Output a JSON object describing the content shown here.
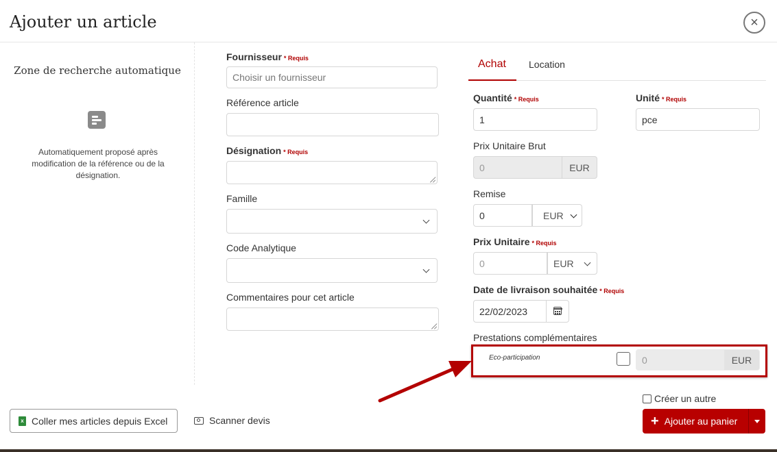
{
  "dialog": {
    "title": "Ajouter un article",
    "close_symbol": "×"
  },
  "auto_zone": {
    "title": "Zone de recherche automatique",
    "icon": "document-icon",
    "description": "Automatiquement proposé après modification de la référence ou de la désignation."
  },
  "required_text": "* Requis",
  "form": {
    "fournisseur": {
      "label": "Fournisseur",
      "placeholder": "Choisir un fournisseur"
    },
    "reference": {
      "label": "Référence article",
      "value": ""
    },
    "designation": {
      "label": "Désignation",
      "value": ""
    },
    "famille": {
      "label": "Famille",
      "value": ""
    },
    "code_analytique": {
      "label": "Code Analytique",
      "value": ""
    },
    "commentaires": {
      "label": "Commentaires pour cet article",
      "value": ""
    }
  },
  "tabs": [
    {
      "label": "Achat",
      "active": true
    },
    {
      "label": "Location",
      "active": false
    }
  ],
  "achat": {
    "quantite": {
      "label": "Quantité",
      "value": "1"
    },
    "unite": {
      "label": "Unité",
      "value": "pce"
    },
    "prix_brut": {
      "label": "Prix Unitaire Brut",
      "placeholder": "0",
      "currency": "EUR"
    },
    "remise": {
      "label": "Remise",
      "value": "0",
      "currency": "EUR"
    },
    "prix_unitaire": {
      "label": "Prix Unitaire",
      "placeholder": "0",
      "currency": "EUR"
    },
    "date_livraison": {
      "label": "Date de livraison souhaitée",
      "value": "22/02/2023"
    },
    "prestations": {
      "label": "Prestations complémentaires",
      "eco": {
        "label": "Eco-participation",
        "placeholder": "0",
        "currency": "EUR",
        "checked": false
      }
    }
  },
  "footer": {
    "excel_button": "Coller mes articles depuis Excel",
    "scan_label": "Scanner devis",
    "creer_label": "Créer un autre",
    "add_button": "Ajouter au panier"
  },
  "colors": {
    "accent": "#b80000",
    "highlight_border": "#b30000"
  }
}
